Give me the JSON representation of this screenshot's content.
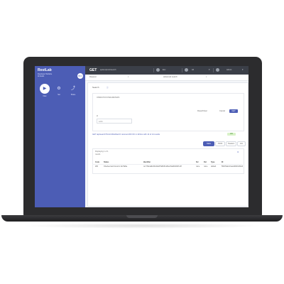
{
  "sidebar": {
    "brand": "RestLab",
    "subtitle_1": "Developer Website",
    "subtitle_2": "AI Assist",
    "logo_text": "BIO",
    "buttons": [
      {
        "label": "New",
        "icon": "play-icon"
      },
      {
        "label": "Set",
        "icon": "gear-icon"
      },
      {
        "label": "Share",
        "icon": "share-icon"
      }
    ]
  },
  "topbar": {
    "method": "GET",
    "url": "api/endpoint/search",
    "env_label": "Env",
    "user_label": "All",
    "account_label": "Admin"
  },
  "subbar": {
    "left_label": "Request",
    "mid_label": "advanced search"
  },
  "request": {
    "section_title": "Search",
    "subsection_title": "OPERATION PARAMETERS",
    "field_label": "id",
    "field_value": "1234",
    "reset_label": "Reset/Clear",
    "cancel_label": "Cancel",
    "send_label": "GET"
  },
  "status": {
    "text": "GET /api/search?limit=20&offset=0 returned 200 OK in 423ms with 14 of 14 results",
    "badge": "200"
  },
  "tabs": [
    {
      "label": "Table",
      "active": true
    },
    {
      "label": "JSON",
      "active": false
    },
    {
      "label": "Headers",
      "active": false
    },
    {
      "label": "Info",
      "active": false
    },
    {
      "label": "Snippets",
      "active": false
    }
  ],
  "results": {
    "showing": "Displaying 1 of 1",
    "sub": "results",
    "columns": [
      "Code",
      "Status",
      "Identifier",
      "Src",
      "Dst",
      "Type",
      "ID"
    ],
    "rows": [
      [
        "200",
        "Checked and found in list/Table",
        "ref-7f3e4a9c2b1d0e8f7a6b5c4d3e2f1a0b9c8d7e6f",
        "none",
        "none",
        "default",
        "5f9d74abc01e2a3b8c4d5e6f"
      ]
    ]
  }
}
